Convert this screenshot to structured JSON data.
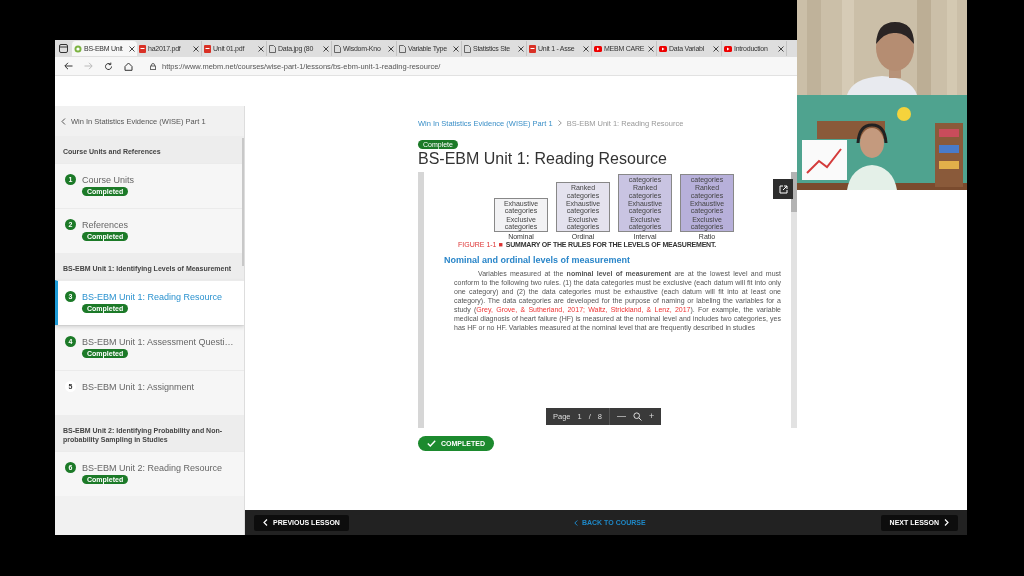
{
  "browser": {
    "tabs": [
      {
        "label": "BS-EBM Unit",
        "kind": "site",
        "selected": true
      },
      {
        "label": "ha2017.pdf",
        "kind": "pdf",
        "selected": false
      },
      {
        "label": "Unit 01.pdf",
        "kind": "pdf",
        "selected": false
      },
      {
        "label": "Data.jpg (80",
        "kind": "doc",
        "selected": false
      },
      {
        "label": "Wisdom-Kno",
        "kind": "doc",
        "selected": false
      },
      {
        "label": "Variable Type",
        "kind": "doc",
        "selected": false
      },
      {
        "label": "Statistics Ste",
        "kind": "doc",
        "selected": false
      },
      {
        "label": "Unit 1 - Asse",
        "kind": "pdf",
        "selected": false
      },
      {
        "label": "MEBM CARE",
        "kind": "video",
        "selected": false
      },
      {
        "label": "Data Variabl",
        "kind": "video",
        "selected": false
      },
      {
        "label": "Introduction",
        "kind": "video",
        "selected": false
      }
    ],
    "url": "https://www.mebm.net/courses/wise-part-1/lessons/bs-ebm-unit-1-reading-resource/"
  },
  "sidebar": {
    "back_link": "Win In Statistics Evidence (WISE) Part 1",
    "sections": [
      {
        "title": "Course Units and References",
        "items": [
          {
            "number": "1",
            "title": "Course Units",
            "completed": true,
            "status": "Completed",
            "selected": false
          },
          {
            "number": "2",
            "title": "References",
            "completed": true,
            "status": "Completed",
            "selected": false
          }
        ]
      },
      {
        "title": "BS-EBM Unit 1: Identifying Levels of Measurement",
        "items": [
          {
            "number": "3",
            "title": "BS-EBM Unit 1: Reading Resource",
            "completed": true,
            "status": "Completed",
            "selected": true
          },
          {
            "number": "4",
            "title": "BS-EBM Unit 1: Assessment Questi…",
            "completed": true,
            "status": "Completed",
            "selected": false
          },
          {
            "number": "5",
            "title": "BS-EBM Unit 1: Assignment",
            "completed": false,
            "selected": false
          }
        ]
      },
      {
        "title": "BS-EBM Unit 2: Identifying Probability and Non-probability Sampling in Studies",
        "items": [
          {
            "number": "6",
            "title": "BS-EBM Unit 2: Reading Resource",
            "completed": true,
            "status": "Completed",
            "selected": false
          }
        ]
      }
    ]
  },
  "lesson": {
    "breadcrumb": [
      "Win In Statistics Evidence (WISE) Part 1",
      "BS-EBM Unit 1: Reading Resource"
    ],
    "status_badge": "Complete",
    "title": "BS-EBM Unit 1: Reading Resource",
    "document": {
      "figure": {
        "columns": [
          {
            "label": "Nominal",
            "items": [
              "Exhaustive categories",
              "Exclusive categories"
            ]
          },
          {
            "label": "Ordinal",
            "items": [
              "Ranked categories",
              "Exhaustive categories",
              "Exclusive categories"
            ]
          },
          {
            "label": "Interval",
            "items": [
              "categories",
              "Ranked categories",
              "Exhaustive categories",
              "Exclusive categories"
            ]
          },
          {
            "label": "Ratio",
            "items": [
              "categories",
              "Ranked categories",
              "Exhaustive categories",
              "Exclusive categories"
            ]
          }
        ],
        "caption_label": "FIGURE 1-1 ■",
        "caption": "SUMMARY OF THE RULES FOR THE LEVELS OF MEASUREMENT."
      },
      "heading": "Nominal and ordinal levels of measurement",
      "paragraph_start": "Variables measured at the **nominal level of measurement** are at the lowest level and must conform to the following two rules. (1) the data categories must be exclusive (each datum will fit into only one category) and (2) the data categories must be exhaustive (each datum will fit into at least one category). The data categories are developed for the purpose of naming or labeling the variables for a study (",
      "citation": "Grey, Grove, & Sutherland, 2017; Waltz, Strickland, & Lenz, 2017",
      "paragraph_end": "). For example, the variable medical diagnosis of heart failure (HF) is measured at the nominal level and includes two categories, yes has HF or no HF. Variables measured at the nominal level that are frequently described in studies",
      "toolbar": {
        "page_label": "Page",
        "page": "1",
        "separator": "/",
        "total": "8",
        "zoom_out": "—",
        "zoom_in": "+"
      }
    },
    "complete_button": "COMPLETED"
  },
  "footer": {
    "previous": "PREVIOUS LESSON",
    "back": "BACK TO COURSE",
    "next": "NEXT LESSON"
  }
}
